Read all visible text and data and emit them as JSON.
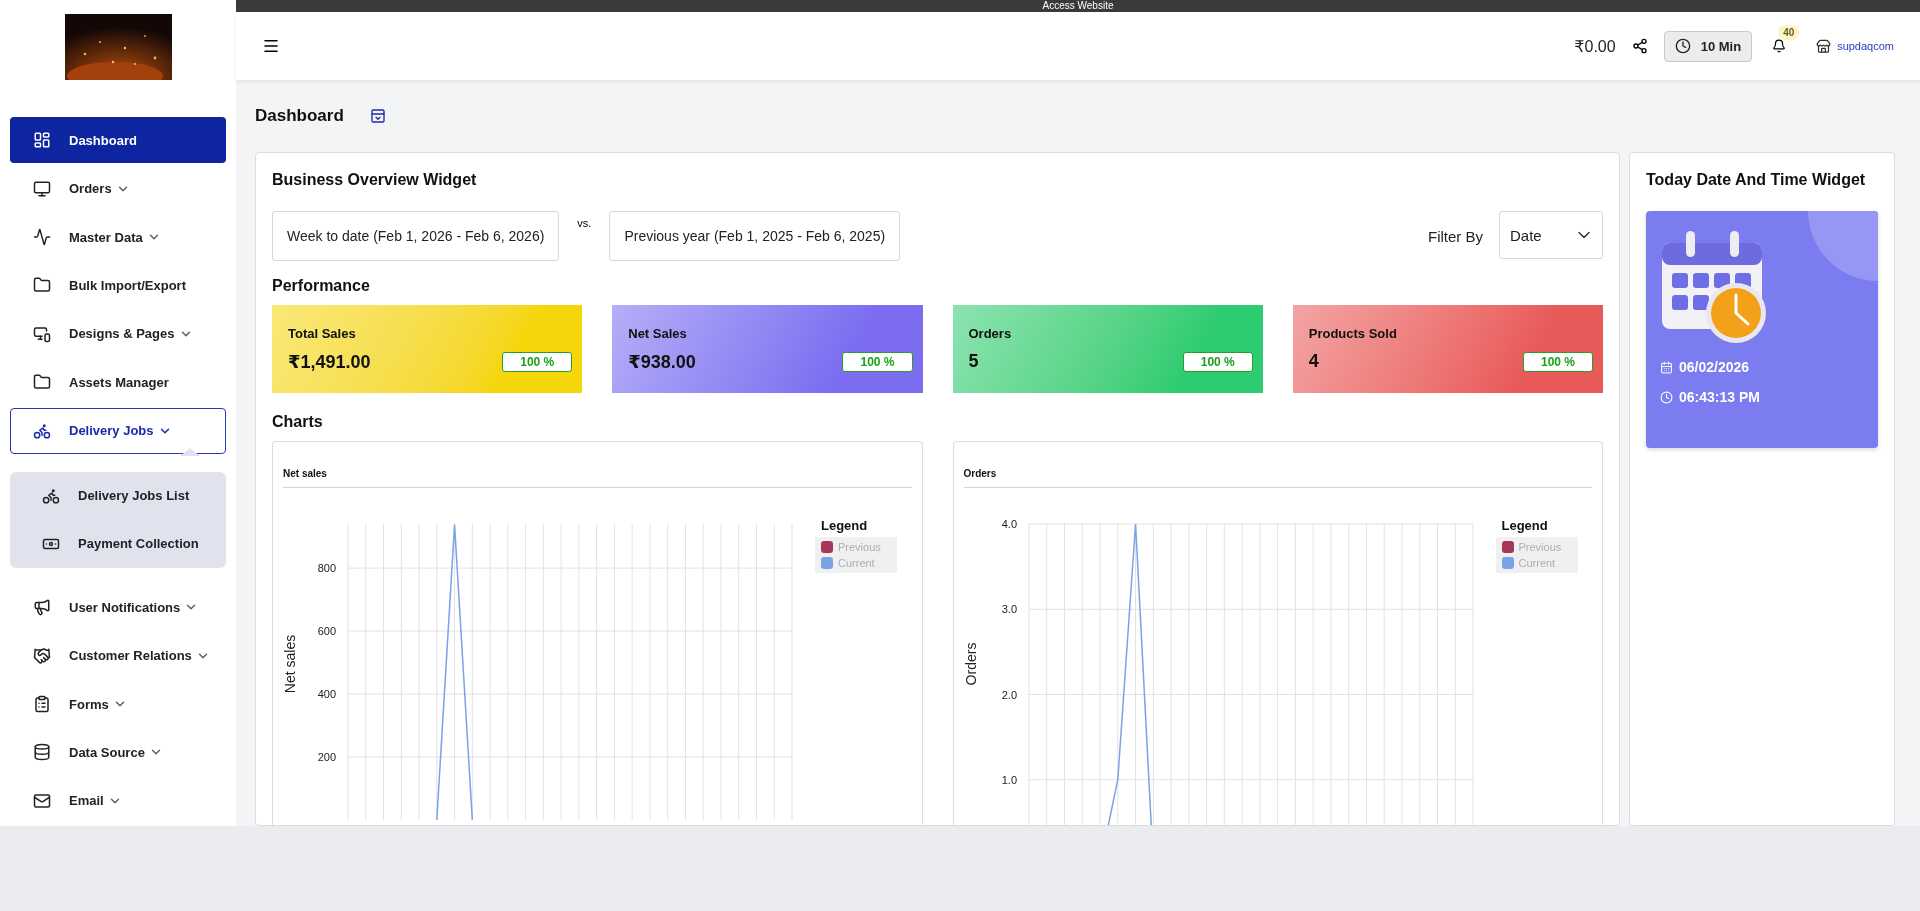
{
  "top_strip": {
    "label": "Access Website"
  },
  "sidebar": {
    "items": [
      {
        "label": "Dashboard",
        "kind": "link",
        "selected": true
      },
      {
        "label": "Orders",
        "kind": "group",
        "selected": false,
        "expanded": false
      },
      {
        "label": "Master Data",
        "kind": "group",
        "selected": false,
        "expanded": false
      },
      {
        "label": "Bulk Import/Export",
        "kind": "link",
        "selected": false
      },
      {
        "label": "Designs & Pages",
        "kind": "group",
        "selected": false,
        "expanded": false
      },
      {
        "label": "Assets Manager",
        "kind": "link",
        "selected": false
      },
      {
        "label": "Delivery Jobs",
        "kind": "group",
        "selected": false,
        "expanded": true,
        "children": [
          {
            "label": "Delivery Jobs List"
          },
          {
            "label": "Payment Collection"
          }
        ]
      },
      {
        "label": "User Notifications",
        "kind": "group",
        "selected": false,
        "expanded": false
      },
      {
        "label": "Customer Relations",
        "kind": "group",
        "selected": false,
        "expanded": false
      },
      {
        "label": "Forms",
        "kind": "group",
        "selected": false,
        "expanded": false
      },
      {
        "label": "Data Source",
        "kind": "group",
        "selected": false,
        "expanded": false
      },
      {
        "label": "Email",
        "kind": "group",
        "selected": false,
        "expanded": false
      }
    ]
  },
  "header": {
    "balance": "₹0.00",
    "timer": "10 Min",
    "notifications": "40",
    "store": "supdaqcom"
  },
  "page_title": "Dashboard",
  "business_overview": {
    "title": "Business Overview Widget",
    "date_range": "Week to date (Feb 1, 2026 - Feb 6, 2026)",
    "vs": "vs.",
    "compare_range": "Previous year (Feb 1, 2025 - Feb 6, 2025)",
    "filter_label": "Filter By",
    "filter": {
      "value": "Date"
    },
    "performance_title": "Performance",
    "cards": [
      {
        "label": "Total Sales",
        "value": "₹1,491.00",
        "change": "100 %",
        "color": "#f5d60a"
      },
      {
        "label": "Net Sales",
        "value": "₹938.00",
        "change": "100 %",
        "color": "#7b6cf0"
      },
      {
        "label": "Orders",
        "value": "5",
        "change": "100 %",
        "color": "#2ecc71"
      },
      {
        "label": "Products Sold",
        "value": "4",
        "change": "100 %",
        "color": "#e85a5a"
      }
    ],
    "charts_title": "Charts",
    "charts": [
      {
        "title": "Net sales",
        "legend_title": "Legend",
        "chart_data": {
          "type": "line",
          "ylabel": "Net sales",
          "grid": true,
          "ylim": [
            0,
            940
          ],
          "yticks": [
            200,
            400,
            600,
            800
          ],
          "series": [
            {
              "name": "Previous",
              "color": "#a8365a",
              "values": [
                null,
                null,
                null,
                null,
                null,
                null,
                null,
                null,
                null,
                null,
                null,
                null,
                null,
                null,
                null,
                null,
                null,
                null,
                null,
                null,
                null,
                null,
                null,
                null,
                null,
                null
              ]
            },
            {
              "name": "Current",
              "color": "#7aa3e5",
              "values": [
                null,
                null,
                null,
                null,
                null,
                0,
                938,
                0,
                null,
                null,
                null,
                null,
                null,
                null,
                null,
                null,
                null,
                null,
                null,
                null,
                null,
                null,
                null,
                null,
                null,
                null
              ]
            }
          ]
        }
      },
      {
        "title": "Orders",
        "legend_title": "Legend",
        "chart_data": {
          "type": "line",
          "ylabel": "Orders",
          "grid": true,
          "ylim": [
            0,
            4
          ],
          "yticks": [
            {
              "value": 1,
              "label": "1.0"
            },
            {
              "value": 2,
              "label": "2.0"
            },
            {
              "value": 3,
              "label": "3.0"
            },
            {
              "value": 4,
              "label": "4.0"
            }
          ],
          "series": [
            {
              "name": "Previous",
              "color": "#a8365a",
              "values": [
                null,
                null,
                null,
                null,
                null,
                null,
                null,
                null,
                null,
                null,
                null,
                null,
                null,
                null,
                null,
                null,
                null,
                null,
                null,
                null,
                null,
                null,
                null,
                null,
                null,
                null
              ]
            },
            {
              "name": "Current",
              "color": "#7aa3e5",
              "values": [
                null,
                null,
                null,
                null,
                0,
                1,
                4,
                0,
                null,
                null,
                null,
                null,
                null,
                null,
                null,
                null,
                null,
                null,
                null,
                null,
                null,
                null,
                null,
                null,
                null,
                null
              ]
            }
          ]
        }
      }
    ]
  },
  "date_time_widget": {
    "title": "Today Date And Time Widget",
    "date": "06/02/2026",
    "time": "06:43:13 PM"
  }
}
